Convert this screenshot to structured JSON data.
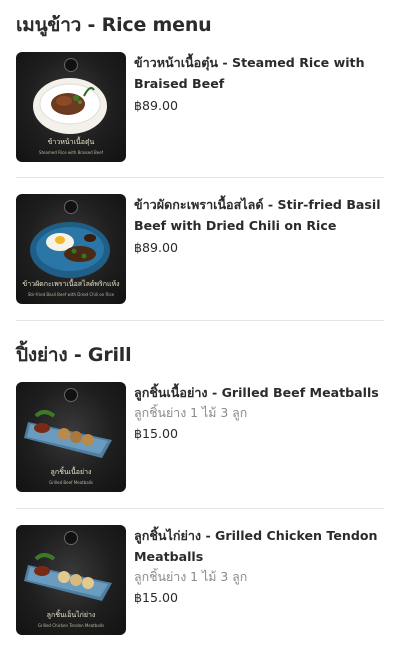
{
  "sections": [
    {
      "title": "เมนูข้าว - Rice menu",
      "items": [
        {
          "name": "ข้าวหน้าเนื้อตุ๋น - Steamed Rice with Braised Beef",
          "price": "฿89.00",
          "image_caption": "ข้าวหน้าเนื้อตุ๋น",
          "image_subcaption": "Steamed Rice with Braised Beef"
        },
        {
          "name": "ข้าวผัดกะเพราเนื้อสไลด์ - Stir-fried Basil Beef with Dried Chili on Rice",
          "price": "฿89.00",
          "image_caption": "ข้าวผัดกะเพราเนื้อสไลด์พริกแห้ง",
          "image_subcaption": "Stir-fried Basil Beef with Dried Chili on Rice"
        }
      ]
    },
    {
      "title": "ปิ้งย่าง - Grill",
      "items": [
        {
          "name": "ลูกชิ้นเนื้อย่าง - Grilled Beef Meatballs",
          "description": "ลูกชิ้นย่าง 1 ไม้ 3 ลูก",
          "price": "฿15.00",
          "image_caption": "ลูกชิ้นเนื้อย่าง",
          "image_subcaption": "Grilled Beef Meatballs"
        },
        {
          "name": "ลูกชิ้นไก่ย่าง - Grilled Chicken Tendon Meatballs",
          "description": "ลูกชิ้นย่าง 1 ไม้ 3 ลูก",
          "price": "฿15.00",
          "image_caption": "ลูกชิ้นเอ็นไก่ย่าง",
          "image_subcaption": "Grilled Chicken Tendon Meatballs"
        }
      ]
    }
  ]
}
